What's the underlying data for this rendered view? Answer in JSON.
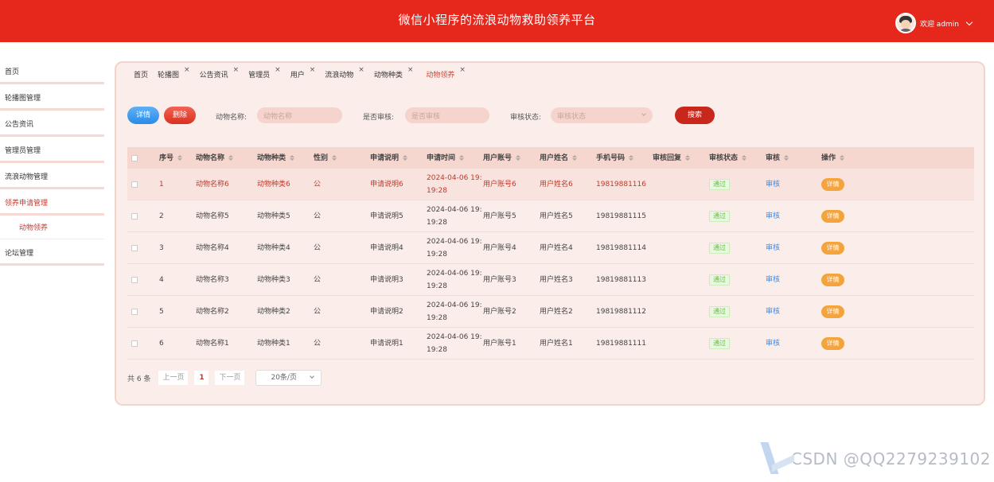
{
  "header": {
    "title": "微信小程序的流浪动物救助领养平台",
    "user_label": "欢迎 admin"
  },
  "sidebar": {
    "items": [
      {
        "label": "首页"
      },
      {
        "label": "轮播图管理"
      },
      {
        "label": "公告资讯"
      },
      {
        "label": "管理员管理"
      },
      {
        "label": "流浪动物管理"
      },
      {
        "label": "领养申请管理"
      },
      {
        "label": "动物领养"
      },
      {
        "label": "论坛管理"
      }
    ]
  },
  "tabs": [
    "首页",
    "轮播图",
    "公告资讯",
    "管理员",
    "用户",
    "流浪动物",
    "动物种类",
    "动物领养"
  ],
  "tab_close": "×",
  "toolbar": {
    "detail_label": "详情",
    "delete_label": "删除",
    "animal_name_label": "动物名称:",
    "animal_name_placeholder": "动物名称",
    "reviewed_label": "是否审核:",
    "reviewed_placeholder": "是否审核",
    "status_label": "审核状态:",
    "status_placeholder": "审核状态",
    "search_label": "搜索"
  },
  "table": {
    "headers": [
      "序号",
      "动物名称",
      "动物种类",
      "性别",
      "申请说明",
      "申请时间",
      "用户账号",
      "用户姓名",
      "手机号码",
      "审核回复",
      "审核状态",
      "审核",
      "操作"
    ],
    "rows": [
      {
        "no": "1",
        "name": "动物名称6",
        "kind": "动物种类6",
        "sex": "公",
        "desc": "申请说明6",
        "time1": "2024-04-06 19:",
        "time2": "19:28",
        "account": "用户账号6",
        "uname": "用户姓名6",
        "phone": "19819881116",
        "reply": "",
        "status": "通过",
        "audit": "审核",
        "op": "详情"
      },
      {
        "no": "2",
        "name": "动物名称5",
        "kind": "动物种类5",
        "sex": "公",
        "desc": "申请说明5",
        "time1": "2024-04-06 19:",
        "time2": "19:28",
        "account": "用户账号5",
        "uname": "用户姓名5",
        "phone": "19819881115",
        "reply": "",
        "status": "通过",
        "audit": "审核",
        "op": "详情"
      },
      {
        "no": "3",
        "name": "动物名称4",
        "kind": "动物种类4",
        "sex": "公",
        "desc": "申请说明4",
        "time1": "2024-04-06 19:",
        "time2": "19:28",
        "account": "用户账号4",
        "uname": "用户姓名4",
        "phone": "19819881114",
        "reply": "",
        "status": "通过",
        "audit": "审核",
        "op": "详情"
      },
      {
        "no": "4",
        "name": "动物名称3",
        "kind": "动物种类3",
        "sex": "公",
        "desc": "申请说明3",
        "time1": "2024-04-06 19:",
        "time2": "19:28",
        "account": "用户账号3",
        "uname": "用户姓名3",
        "phone": "19819881113",
        "reply": "",
        "status": "通过",
        "audit": "审核",
        "op": "详情"
      },
      {
        "no": "5",
        "name": "动物名称2",
        "kind": "动物种类2",
        "sex": "公",
        "desc": "申请说明2",
        "time1": "2024-04-06 19:",
        "time2": "19:28",
        "account": "用户账号2",
        "uname": "用户姓名2",
        "phone": "19819881112",
        "reply": "",
        "status": "通过",
        "audit": "审核",
        "op": "详情"
      },
      {
        "no": "6",
        "name": "动物名称1",
        "kind": "动物种类1",
        "sex": "公",
        "desc": "申请说明1",
        "time1": "2024-04-06 19:",
        "time2": "19:28",
        "account": "用户账号1",
        "uname": "用户姓名1",
        "phone": "19819881111",
        "reply": "",
        "status": "通过",
        "audit": "审核",
        "op": "详情"
      }
    ]
  },
  "pager": {
    "total": "共 6 条",
    "prev": "上一页",
    "page": "1",
    "next": "下一页",
    "size": "20条/页"
  },
  "watermark": "CSDN @QQ2279239102"
}
